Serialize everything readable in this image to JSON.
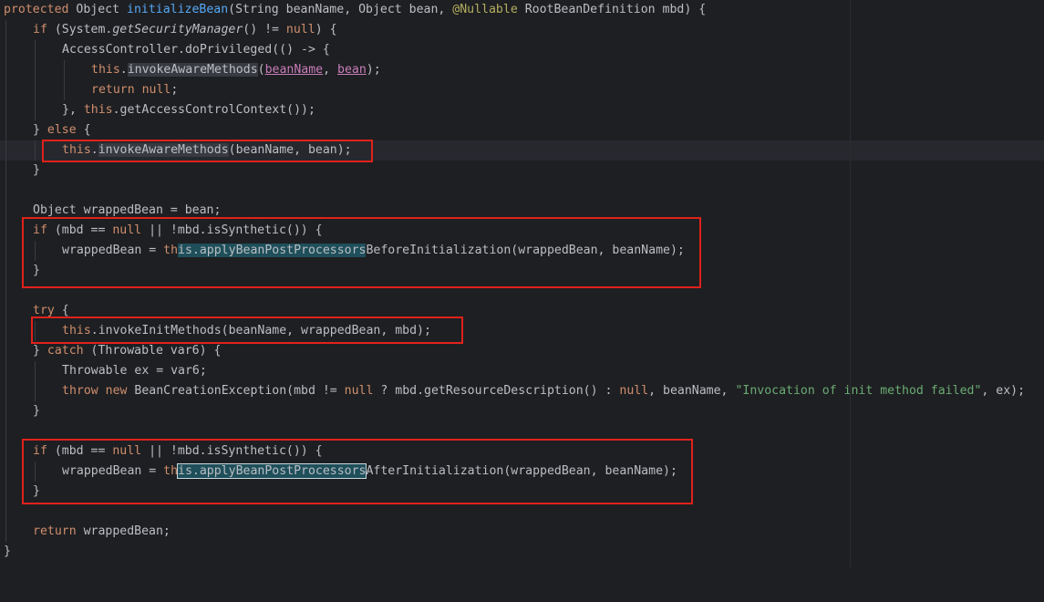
{
  "colors": {
    "background": "#1e1f22",
    "keyword": "#cf8e6d",
    "method_declaration": "#56a8f5",
    "annotation": "#b3ae60",
    "string": "#6aab73",
    "parameter": "#c77dba",
    "highlight_box": "#e0211b"
  },
  "code": {
    "l1": [
      "protected",
      " Object ",
      "initializeBean",
      "(String beanName, Object bean, ",
      "@Nullable",
      " RootBeanDefinition mbd) {"
    ],
    "l2": [
      "if",
      " (System.",
      "getSecurityManager",
      "() != ",
      "null",
      ") {"
    ],
    "l3": [
      "AccessController.doPrivileged(() -> {"
    ],
    "l4": [
      "this",
      ".",
      "invokeAwareMethods",
      "(",
      "beanName",
      ", ",
      "bean",
      ");"
    ],
    "l5": [
      "return",
      " ",
      "null",
      ";"
    ],
    "l6": [
      "}, ",
      "this",
      ".getAccessControlContext());"
    ],
    "l7": [
      "} ",
      "else",
      " {"
    ],
    "l8": [
      "this",
      ".",
      "invokeAwareMethods",
      "(beanName, bean);"
    ],
    "l9": [
      "}"
    ],
    "l11": [
      "Object wrappedBean = bean;"
    ],
    "l12": [
      "if",
      " (mbd == ",
      "null",
      " || !mbd.isSynthetic()) {"
    ],
    "l13": [
      "wrappedBean = ",
      "th",
      "is.applyBeanPostProcessors",
      "BeforeInitialization(wrappedBean, beanName);"
    ],
    "l14": [
      "}"
    ],
    "l16": [
      "try",
      " {"
    ],
    "l17": [
      "this",
      ".invokeInitMethods(beanName, wrappedBean, mbd);"
    ],
    "l18": [
      "} ",
      "catch",
      " (Throwable var6) {"
    ],
    "l19": [
      "Throwable ex = var6;"
    ],
    "l20": [
      "throw",
      " ",
      "new",
      " BeanCreationException(mbd != ",
      "null",
      " ? mbd.getResourceDescription() : ",
      "null",
      ", beanName, ",
      "\"Invocation of init method failed\"",
      ", ex);"
    ],
    "l21": [
      "}"
    ],
    "l23": [
      "if",
      " (mbd == ",
      "null",
      " || !mbd.isSynthetic()) {"
    ],
    "l24": [
      "wrappedBean = ",
      "th",
      "is.applyBeanPostProcessors",
      "AfterInitialization(wrappedBean, beanName);"
    ],
    "l25": [
      "}"
    ],
    "l27": [
      "return",
      " wrappedBean;"
    ],
    "l28": [
      "}"
    ]
  }
}
